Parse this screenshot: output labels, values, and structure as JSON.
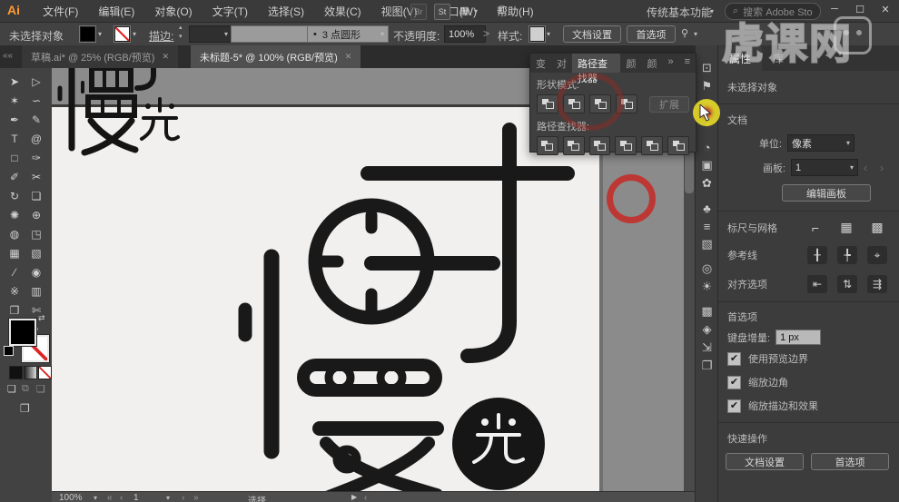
{
  "app": {
    "logo": "Ai",
    "window_title": ""
  },
  "icons": {
    "dropdown": "▾",
    "caret_up": "▴",
    "caret_down": "▾",
    "overflow": "»",
    "panel_menu": "≡",
    "minimize": "─",
    "maximize": "☐",
    "close": "✕",
    "tab_close": "✕",
    "search": "⌕",
    "grid_arrange": "▦",
    "touch": "✆",
    "chevron_right": ">",
    "nav_first": "«",
    "nav_prev": "‹",
    "nav_next": "›",
    "nav_last": "»",
    "play": "▶",
    "back_arrows": "««",
    "swap": "⇄",
    "arrow_left_dim": "‹",
    "arrow_right_dim": "›",
    "bullet": "•"
  },
  "menu_bar": {
    "items": [
      "文件(F)",
      "编辑(E)",
      "对象(O)",
      "文字(T)",
      "选择(S)",
      "效果(C)",
      "视图(V)",
      "窗口(W)",
      "帮助(H)"
    ],
    "bridge_label": "Br",
    "stock_label": "St",
    "workspace": "传统基本功能",
    "search_placeholder": "搜索 Adobe Stock"
  },
  "control_bar": {
    "no_selection": "未选择对象",
    "stroke_label": "描边:",
    "brush_name": "3 点圆形",
    "opacity_label": "不透明度:",
    "opacity_value": "100%",
    "style_label": "样式:",
    "doc_setup": "文档设置",
    "preferences": "首选项"
  },
  "document_tabs": [
    {
      "title": "草稿.ai* @ 25% (RGB/预览)"
    },
    {
      "title": "未标题-5* @ 100% (RGB/预览)"
    }
  ],
  "tools": [
    {
      "n": "selection-tool-icon",
      "g": "➤"
    },
    {
      "n": "direct-selection-tool-icon",
      "g": "▷"
    },
    {
      "n": "magic-wand-tool-icon",
      "g": "✶"
    },
    {
      "n": "lasso-tool-icon",
      "g": "∽"
    },
    {
      "n": "pen-tool-icon",
      "g": "✒"
    },
    {
      "n": "curvature-tool-icon",
      "g": "✎"
    },
    {
      "n": "type-tool-icon",
      "g": "T"
    },
    {
      "n": "spiral-tool-icon",
      "g": "@"
    },
    {
      "n": "rectangle-tool-icon",
      "g": "□"
    },
    {
      "n": "paintbrush-tool-icon",
      "g": "✑"
    },
    {
      "n": "shaper-tool-icon",
      "g": "✐"
    },
    {
      "n": "scissors-tool-icon",
      "g": "✂"
    },
    {
      "n": "rotate-tool-icon",
      "g": "↻"
    },
    {
      "n": "scale-tool-icon",
      "g": "❏"
    },
    {
      "n": "blob-brush-tool-icon",
      "g": "✺"
    },
    {
      "n": "puppet-warp-tool-icon",
      "g": "⊕"
    },
    {
      "n": "shape-builder-tool-icon",
      "g": "◍"
    },
    {
      "n": "free-transform-tool-icon",
      "g": "◳"
    },
    {
      "n": "mesh-tool-icon",
      "g": "▦"
    },
    {
      "n": "gradient-tool-icon",
      "g": "▧"
    },
    {
      "n": "eyedropper-tool-icon",
      "g": "∕"
    },
    {
      "n": "blend-tool-icon",
      "g": "◉"
    },
    {
      "n": "symbol-sprayer-tool-icon",
      "g": "※"
    },
    {
      "n": "column-graph-tool-icon",
      "g": "▥"
    },
    {
      "n": "artboard-tool-icon",
      "g": "❐"
    },
    {
      "n": "slice-tool-icon",
      "g": "✄"
    },
    {
      "n": "hand-tool-icon",
      "g": "☜"
    },
    {
      "n": "zoom-tool-icon",
      "g": "⌕"
    }
  ],
  "pathfinder": {
    "tabs": [
      "变",
      "对",
      "路径查找器",
      "颜",
      "颜"
    ],
    "active_tab": "路径查找器",
    "shape_modes_label": "形状模式:",
    "pathfinders_label": "路径查找器:",
    "expand_button": "扩展",
    "shape_mode_icons": [
      {
        "n": "unite-icon"
      },
      {
        "n": "minus-front-icon"
      },
      {
        "n": "intersect-icon"
      },
      {
        "n": "exclude-icon"
      }
    ],
    "pathfinder_icons": [
      {
        "n": "divide-icon"
      },
      {
        "n": "trim-icon"
      },
      {
        "n": "merge-icon"
      },
      {
        "n": "crop-icon"
      },
      {
        "n": "outline-icon"
      },
      {
        "n": "minus-back-icon"
      }
    ]
  },
  "dock_icons": [
    {
      "n": "transform-panel-icon",
      "g": "⊡"
    },
    {
      "n": "artboards-panel-icon",
      "g": "⚑"
    },
    {
      "n": "pathfinder-panel-icon",
      "g": "⧉"
    },
    {
      "n": "color-panel-icon",
      "g": "◑"
    },
    {
      "n": "color-guide-panel-icon",
      "g": "◔"
    },
    {
      "n": "links-panel-icon",
      "g": "▣"
    },
    {
      "n": "brushes-panel-icon",
      "g": "✿"
    },
    {
      "n": "symbols-panel-icon",
      "g": "♣"
    },
    {
      "n": "stroke-panel-icon",
      "g": "≡"
    },
    {
      "n": "gradient-panel-icon",
      "g": "▧"
    },
    {
      "n": "transparency-panel-icon",
      "g": "◎"
    },
    {
      "n": "appearance-panel-icon",
      "g": "☀"
    },
    {
      "n": "graphic-styles-panel-icon",
      "g": "▩"
    },
    {
      "n": "layers-panel-icon",
      "g": "◈"
    },
    {
      "n": "asset-export-panel-icon",
      "g": "⇲"
    },
    {
      "n": "artboards2-panel-icon",
      "g": "❐"
    }
  ],
  "properties": {
    "tab_properties": "属性",
    "tab_library": "库",
    "no_selection": "未选择对象",
    "document_label": "文档",
    "unit_label": "单位:",
    "unit_value": "像素",
    "artboard_label": "画板:",
    "artboard_value": "1",
    "edit_artboard": "编辑画板",
    "rulers_label": "标尺与网格",
    "rulers_icons": [
      {
        "n": "corner-ruler-icon",
        "g": "⌐"
      },
      {
        "n": "grid-icon",
        "g": "▦"
      },
      {
        "n": "transparency-grid-icon",
        "g": "▩"
      }
    ],
    "guides_label": "参考线",
    "guides_icons": [
      {
        "n": "show-guides-icon",
        "g": "╂"
      },
      {
        "n": "lock-guides-icon",
        "g": "╄"
      },
      {
        "n": "smart-guides-icon",
        "g": "⌖"
      }
    ],
    "snap_label": "对齐选项",
    "snap_icons": [
      {
        "n": "snap-grid-icon",
        "g": "⇤"
      },
      {
        "n": "snap-point-icon",
        "g": "⇅"
      },
      {
        "n": "snap-pixel-icon",
        "g": "⇶"
      }
    ],
    "prefs_label": "首选项",
    "keyboard_label": "键盘增量:",
    "keyboard_value": "1 px",
    "checkboxes": [
      {
        "label": "使用预览边界",
        "checked": "✔"
      },
      {
        "label": "缩放边角",
        "checked": "✔"
      },
      {
        "label": "缩放描边和效果",
        "checked": "✔"
      }
    ],
    "quick_actions_label": "快速操作",
    "qa_doc_setup": "文档设置",
    "qa_preferences": "首选项"
  },
  "status_bar": {
    "zoom": "100%",
    "artboard_nav": "1",
    "status": "选择"
  },
  "watermark": {
    "text": "虎课网"
  },
  "colors": {
    "panel": "#3c3c3c",
    "bar": "#424242",
    "pasteboard": "#8b8b8b",
    "artboard": "#f1f0ee",
    "artwork_black": "#191919",
    "annotation_red": "#c42c28",
    "click_highlight": "#ded428",
    "logo_orange": "#ff9a33"
  }
}
